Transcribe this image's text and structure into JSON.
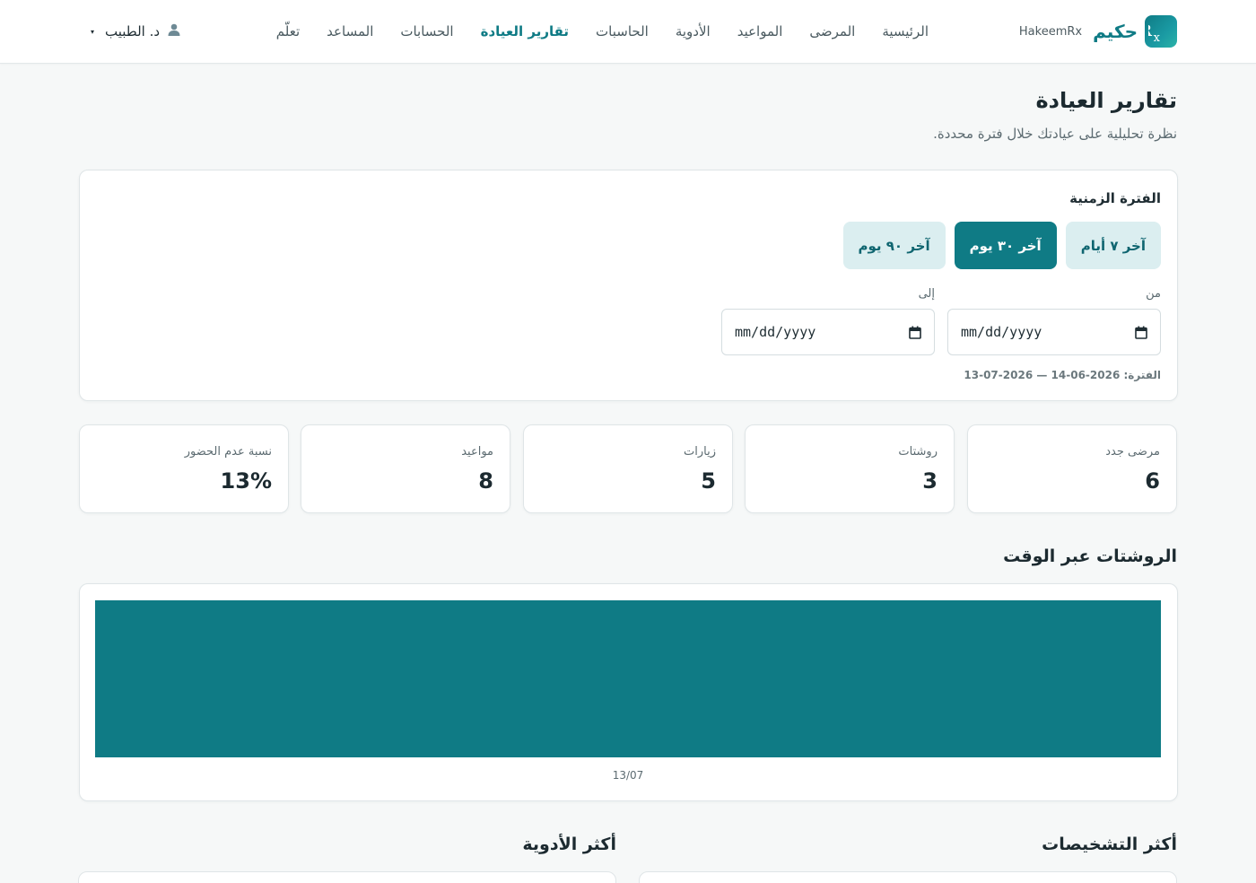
{
  "brand": {
    "name_ar": "حكيم",
    "name_en": "HakeemRx"
  },
  "nav": {
    "links": [
      {
        "label": "الرئيسية",
        "active": false
      },
      {
        "label": "المرضى",
        "active": false
      },
      {
        "label": "المواعيد",
        "active": false
      },
      {
        "label": "الأدوية",
        "active": false
      },
      {
        "label": "الحاسبات",
        "active": false
      },
      {
        "label": "تقارير العيادة",
        "active": true
      },
      {
        "label": "الحسابات",
        "active": false
      },
      {
        "label": "المساعد",
        "active": false
      },
      {
        "label": "تعلّم",
        "active": false
      }
    ],
    "user": {
      "name": "د. الطبيب",
      "icon": "user-icon",
      "caret": "▾"
    }
  },
  "page": {
    "title": "تقارير العيادة",
    "subtitle": "نظرة تحليلية على عيادتك خلال فترة محددة."
  },
  "period": {
    "label": "الفترة الزمنية",
    "ranges": [
      {
        "label": "آخر ٧ أيام",
        "active": false
      },
      {
        "label": "آخر ٣٠ يوم",
        "active": true
      },
      {
        "label": "آخر ٩٠ يوم",
        "active": false
      }
    ],
    "from_label": "من",
    "to_label": "إلى",
    "from_placeholder": "mm/dd/yyyy",
    "to_placeholder": "mm/dd/yyyy",
    "current": "الفترة: 2026-06-14 — 2026-07-13"
  },
  "stats": [
    {
      "label": "مرضى جدد",
      "value": "6"
    },
    {
      "label": "روشتات",
      "value": "3"
    },
    {
      "label": "زيارات",
      "value": "5"
    },
    {
      "label": "مواعيد",
      "value": "8"
    },
    {
      "label": "نسبة عدم الحضور",
      "value": "13%"
    }
  ],
  "prescriptions_chart": {
    "title": "الروشتات عبر الوقت"
  },
  "chart_data": {
    "type": "bar",
    "categories": [
      "13/07"
    ],
    "values": [
      3
    ],
    "title": "الروشتات عبر الوقت",
    "xlabel": "",
    "ylabel": "",
    "ylim": [
      0,
      3
    ],
    "color": "#0f7b85",
    "grid": false
  },
  "bottom": {
    "top_diagnoses_title": "أكثر التشخيصات",
    "top_medications_title": "أكثر الأدوية"
  },
  "colors": {
    "accent": "#0f7b85",
    "accent_light": "#dbeef0",
    "background": "#f6f8f8"
  }
}
